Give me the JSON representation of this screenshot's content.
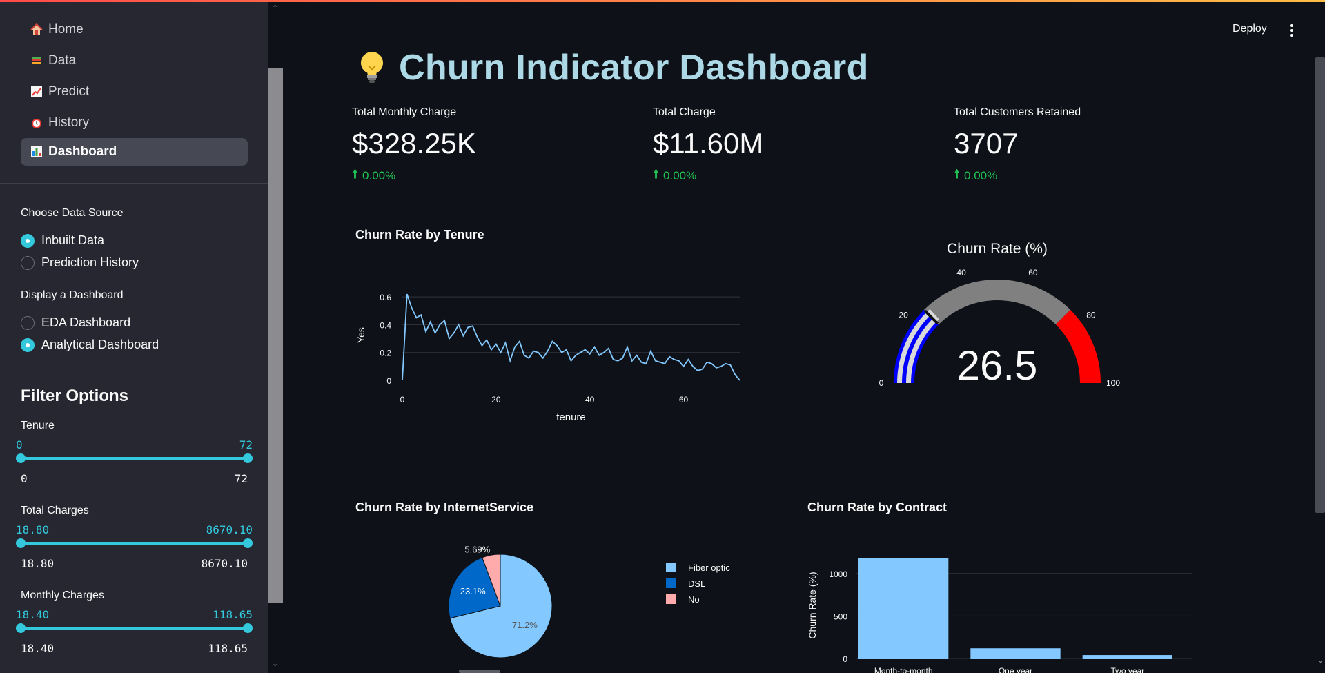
{
  "app": {
    "deploy_label": "Deploy"
  },
  "sidebar": {
    "nav": [
      {
        "label": "Home",
        "icon": "house-icon"
      },
      {
        "label": "Data",
        "icon": "books-icon"
      },
      {
        "label": "Predict",
        "icon": "chart-icon"
      },
      {
        "label": "History",
        "icon": "alarm-clock-icon"
      },
      {
        "label": "Dashboard",
        "icon": "bar-chart-icon",
        "active": true
      }
    ],
    "data_source": {
      "label": "Choose Data Source",
      "options": [
        "Inbuilt Data",
        "Prediction History"
      ],
      "selected": "Inbuilt Data"
    },
    "dashboard_type": {
      "label": "Display a Dashboard",
      "options": [
        "EDA Dashboard",
        "Analytical Dashboard"
      ],
      "selected": "Analytical Dashboard"
    },
    "filter_title": "Filter Options",
    "sliders": [
      {
        "label": "Tenure",
        "low": "0",
        "high": "72",
        "min": "0",
        "max": "72"
      },
      {
        "label": "Total Charges",
        "low": "18.80",
        "high": "8670.10",
        "min": "18.80",
        "max": "8670.10"
      },
      {
        "label": "Monthly Charges",
        "low": "18.40",
        "high": "118.65",
        "min": "18.40",
        "max": "118.65"
      }
    ]
  },
  "main": {
    "title": "Churn Indicator Dashboard",
    "metrics": [
      {
        "label": "Total Monthly Charge",
        "value": "$328.25K",
        "delta": "0.00%"
      },
      {
        "label": "Total Charge",
        "value": "$11.60M",
        "delta": "0.00%"
      },
      {
        "label": "Total Customers Retained",
        "value": "3707",
        "delta": "0.00%"
      }
    ]
  },
  "colors": {
    "accent": "#33c8dc",
    "title": "#add8e6",
    "delta_positive": "#21c354",
    "line": "#83c9ff",
    "gauge_low": "#0000ff",
    "gauge_mid": "#808080",
    "gauge_high": "#ff0000"
  },
  "chart_data": [
    {
      "type": "line",
      "title": "Churn Rate by Tenure",
      "xlabel": "tenure",
      "ylabel": "Yes",
      "xlim": [
        0,
        72
      ],
      "ylim": [
        0,
        0.65
      ],
      "xticks": [
        0,
        20,
        40,
        60
      ],
      "yticks": [
        0,
        0.2,
        0.4,
        0.6
      ],
      "grid": true,
      "x": [
        0,
        1,
        2,
        3,
        4,
        5,
        6,
        7,
        8,
        9,
        10,
        11,
        12,
        13,
        14,
        15,
        16,
        17,
        18,
        19,
        20,
        21,
        22,
        23,
        24,
        25,
        26,
        27,
        28,
        29,
        30,
        31,
        32,
        33,
        34,
        35,
        36,
        37,
        38,
        39,
        40,
        41,
        42,
        43,
        44,
        45,
        46,
        47,
        48,
        49,
        50,
        51,
        52,
        53,
        54,
        55,
        56,
        57,
        58,
        59,
        60,
        61,
        62,
        63,
        64,
        65,
        66,
        67,
        68,
        69,
        70,
        71,
        72
      ],
      "y": [
        0.0,
        0.62,
        0.52,
        0.45,
        0.47,
        0.35,
        0.42,
        0.34,
        0.4,
        0.43,
        0.3,
        0.34,
        0.4,
        0.32,
        0.38,
        0.39,
        0.31,
        0.25,
        0.29,
        0.22,
        0.26,
        0.2,
        0.27,
        0.14,
        0.24,
        0.28,
        0.18,
        0.16,
        0.21,
        0.2,
        0.16,
        0.21,
        0.28,
        0.25,
        0.2,
        0.22,
        0.14,
        0.18,
        0.2,
        0.22,
        0.19,
        0.24,
        0.18,
        0.2,
        0.23,
        0.15,
        0.14,
        0.16,
        0.24,
        0.14,
        0.18,
        0.13,
        0.12,
        0.21,
        0.14,
        0.13,
        0.12,
        0.17,
        0.15,
        0.14,
        0.1,
        0.15,
        0.1,
        0.07,
        0.08,
        0.13,
        0.12,
        0.09,
        0.1,
        0.12,
        0.11,
        0.04,
        0.0
      ]
    },
    {
      "type": "gauge",
      "title": "Churn Rate (%)",
      "value": 26.5,
      "range": [
        0,
        100
      ],
      "ticks": [
        0,
        20,
        40,
        60,
        80,
        100
      ],
      "steps": [
        {
          "range": [
            0,
            25
          ],
          "color": "#0000ff"
        },
        {
          "range": [
            25,
            75
          ],
          "color": "#808080"
        },
        {
          "range": [
            75,
            100
          ],
          "color": "#ff0000"
        }
      ],
      "threshold": 25
    },
    {
      "type": "pie",
      "title": "Churn Rate by InternetService",
      "labels": [
        "Fiber optic",
        "DSL",
        "No"
      ],
      "values": [
        71.2,
        23.1,
        5.69
      ],
      "value_labels": [
        "71.2%",
        "23.1%",
        "5.69%"
      ],
      "colors": [
        "#83c9ff",
        "#0068c9",
        "#ffabab"
      ]
    },
    {
      "type": "bar",
      "title": "Churn Rate by Contract",
      "ylabel": "Churn Rate (%)",
      "categories": [
        "Month-to-month",
        "One year",
        "Two year"
      ],
      "values": [
        1180,
        120,
        40
      ],
      "yticks": [
        0,
        500,
        1000
      ],
      "ylim": [
        0,
        1250
      ],
      "grid": true
    }
  ]
}
